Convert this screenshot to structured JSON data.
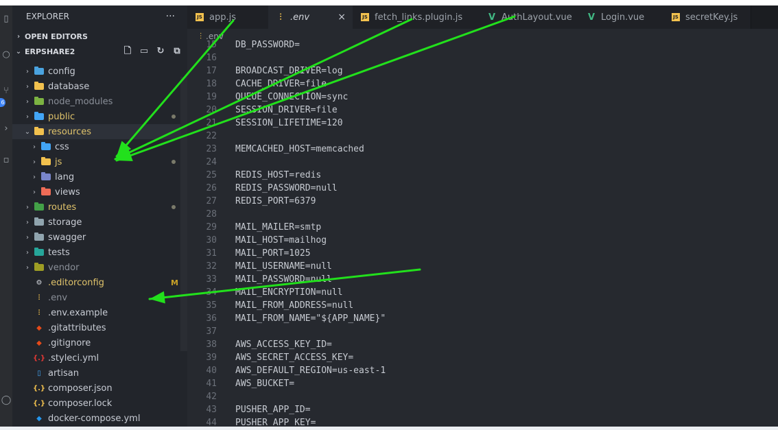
{
  "explorer": {
    "title": "EXPLORER",
    "more_label": "···",
    "open_editors_label": "OPEN EDITORS",
    "project_label": "ERPSHARE2",
    "tree": [
      {
        "label": "config",
        "kind": "folder",
        "color": "#4aa3df",
        "expanded": false,
        "indent": 0,
        "status": ""
      },
      {
        "label": "database",
        "kind": "folder",
        "color": "#f2c14e",
        "expanded": false,
        "indent": 0,
        "status": ""
      },
      {
        "label": "node_modules",
        "kind": "folder",
        "color": "#7cb342",
        "expanded": false,
        "indent": 0,
        "status": "",
        "dim": true
      },
      {
        "label": "public",
        "kind": "folder",
        "color": "#42a5f5",
        "expanded": false,
        "indent": 0,
        "status": "dot"
      },
      {
        "label": "resources",
        "kind": "folder",
        "color": "#f2c14e",
        "expanded": true,
        "indent": 0,
        "status": "",
        "selected": true
      },
      {
        "label": "css",
        "kind": "folder",
        "color": "#42a5f5",
        "expanded": false,
        "indent": 1,
        "status": ""
      },
      {
        "label": "js",
        "kind": "folder",
        "color": "#f2c14e",
        "expanded": false,
        "indent": 1,
        "status": "dot"
      },
      {
        "label": "lang",
        "kind": "folder",
        "color": "#7986cb",
        "expanded": false,
        "indent": 1,
        "status": ""
      },
      {
        "label": "views",
        "kind": "folder",
        "color": "#ef6c57",
        "expanded": false,
        "indent": 1,
        "status": ""
      },
      {
        "label": "routes",
        "kind": "folder",
        "color": "#43a047",
        "expanded": false,
        "indent": 0,
        "status": "dot"
      },
      {
        "label": "storage",
        "kind": "folder",
        "color": "#90a4ae",
        "expanded": false,
        "indent": 0,
        "status": ""
      },
      {
        "label": "swagger",
        "kind": "folder",
        "color": "#90a4ae",
        "expanded": false,
        "indent": 0,
        "status": ""
      },
      {
        "label": "tests",
        "kind": "folder",
        "color": "#26a69a",
        "expanded": false,
        "indent": 0,
        "status": ""
      },
      {
        "label": "vendor",
        "kind": "folder",
        "color": "#9e9d24",
        "expanded": false,
        "indent": 0,
        "status": "",
        "dim": true
      },
      {
        "label": ".editorconfig",
        "kind": "file",
        "icon": "gear-icon",
        "icon_char": "⚙",
        "color": "#d7dae0",
        "indent": 0,
        "status": "M"
      },
      {
        "label": ".env",
        "kind": "file",
        "icon": "sliders-icon",
        "icon_char": "⫶",
        "color": "#f2c14e",
        "indent": 0,
        "status": "",
        "dim": true
      },
      {
        "label": ".env.example",
        "kind": "file",
        "icon": "sliders-icon",
        "icon_char": "⫶",
        "color": "#f2c14e",
        "indent": 0,
        "status": ""
      },
      {
        "label": ".gitattributes",
        "kind": "file",
        "icon": "git-icon",
        "icon_char": "◆",
        "color": "#e64a19",
        "indent": 0,
        "status": ""
      },
      {
        "label": ".gitignore",
        "kind": "file",
        "icon": "git-icon",
        "icon_char": "◆",
        "color": "#e64a19",
        "indent": 0,
        "status": ""
      },
      {
        "label": ".styleci.yml",
        "kind": "file",
        "icon": "braces-icon",
        "icon_char": "{.}",
        "color": "#e53935",
        "indent": 0,
        "status": ""
      },
      {
        "label": "artisan",
        "kind": "file",
        "icon": "document-icon",
        "icon_char": "▯",
        "color": "#42a5f5",
        "indent": 0,
        "status": ""
      },
      {
        "label": "composer.json",
        "kind": "file",
        "icon": "braces-icon",
        "icon_char": "{.}",
        "color": "#f2c14e",
        "indent": 0,
        "status": ""
      },
      {
        "label": "composer.lock",
        "kind": "file",
        "icon": "braces-icon",
        "icon_char": "{.}",
        "color": "#f2c14e",
        "indent": 0,
        "status": ""
      },
      {
        "label": "docker-compose.yml",
        "kind": "file",
        "icon": "whale-icon",
        "icon_char": "◆",
        "color": "#2496ed",
        "indent": 0,
        "status": ""
      }
    ]
  },
  "tabs": [
    {
      "label": "app.js",
      "icon": "js-icon",
      "icon_char": "JS",
      "color": "#f2c14e",
      "active": false
    },
    {
      "label": ".env",
      "icon": "sliders-icon",
      "icon_char": "⫶",
      "color": "#f2c14e",
      "active": true,
      "italic": true,
      "close": "×"
    },
    {
      "label": "fetch_links.plugin.js",
      "icon": "js-icon",
      "icon_char": "JS",
      "color": "#f2c14e",
      "active": false
    },
    {
      "label": "AuthLayout.vue",
      "icon": "vue-icon",
      "icon_char": "V",
      "color": "#41b883",
      "active": false
    },
    {
      "label": "Login.vue",
      "icon": "vue-icon",
      "icon_char": "V",
      "color": "#41b883",
      "active": false
    },
    {
      "label": "secretKey.js",
      "icon": "js-icon",
      "icon_char": "JS",
      "color": "#f2c14e",
      "active": false
    }
  ],
  "breadcrumb": {
    "label": ".env"
  },
  "editor": {
    "lines": [
      {
        "n": "15",
        "text": "DB_PASSWORD="
      },
      {
        "n": "16",
        "text": ""
      },
      {
        "n": "17",
        "text": "BROADCAST_DRIVER=log"
      },
      {
        "n": "18",
        "text": "CACHE_DRIVER=file"
      },
      {
        "n": "19",
        "text": "QUEUE_CONNECTION=sync"
      },
      {
        "n": "20",
        "text": "SESSION_DRIVER=file"
      },
      {
        "n": "21",
        "text": "SESSION_LIFETIME=120"
      },
      {
        "n": "22",
        "text": ""
      },
      {
        "n": "23",
        "text": "MEMCACHED_HOST=memcached"
      },
      {
        "n": "24",
        "text": ""
      },
      {
        "n": "25",
        "text": "REDIS_HOST=redis"
      },
      {
        "n": "26",
        "text": "REDIS_PASSWORD=null"
      },
      {
        "n": "27",
        "text": "REDIS_PORT=6379"
      },
      {
        "n": "28",
        "text": ""
      },
      {
        "n": "29",
        "text": "MAIL_MAILER=smtp"
      },
      {
        "n": "30",
        "text": "MAIL_HOST=mailhog"
      },
      {
        "n": "31",
        "text": "MAIL_PORT=1025"
      },
      {
        "n": "32",
        "text": "MAIL_USERNAME=null"
      },
      {
        "n": "33",
        "text": "MAIL_PASSWORD=null"
      },
      {
        "n": "34",
        "text": "MAIL_ENCRYPTION=null"
      },
      {
        "n": "35",
        "text": "MAIL_FROM_ADDRESS=null"
      },
      {
        "n": "36",
        "text": "MAIL_FROM_NAME=\"${APP_NAME}\""
      },
      {
        "n": "37",
        "text": ""
      },
      {
        "n": "38",
        "text": "AWS_ACCESS_KEY_ID="
      },
      {
        "n": "39",
        "text": "AWS_SECRET_ACCESS_KEY="
      },
      {
        "n": "40",
        "text": "AWS_DEFAULT_REGION=us-east-1"
      },
      {
        "n": "41",
        "text": "AWS_BUCKET="
      },
      {
        "n": "42",
        "text": ""
      },
      {
        "n": "43",
        "text": "PUSHER_APP_ID="
      },
      {
        "n": "44",
        "text": "PUSHER_APP_KEY="
      }
    ]
  },
  "annotation_color": "#22e01c",
  "activity": {
    "badge": "6"
  }
}
